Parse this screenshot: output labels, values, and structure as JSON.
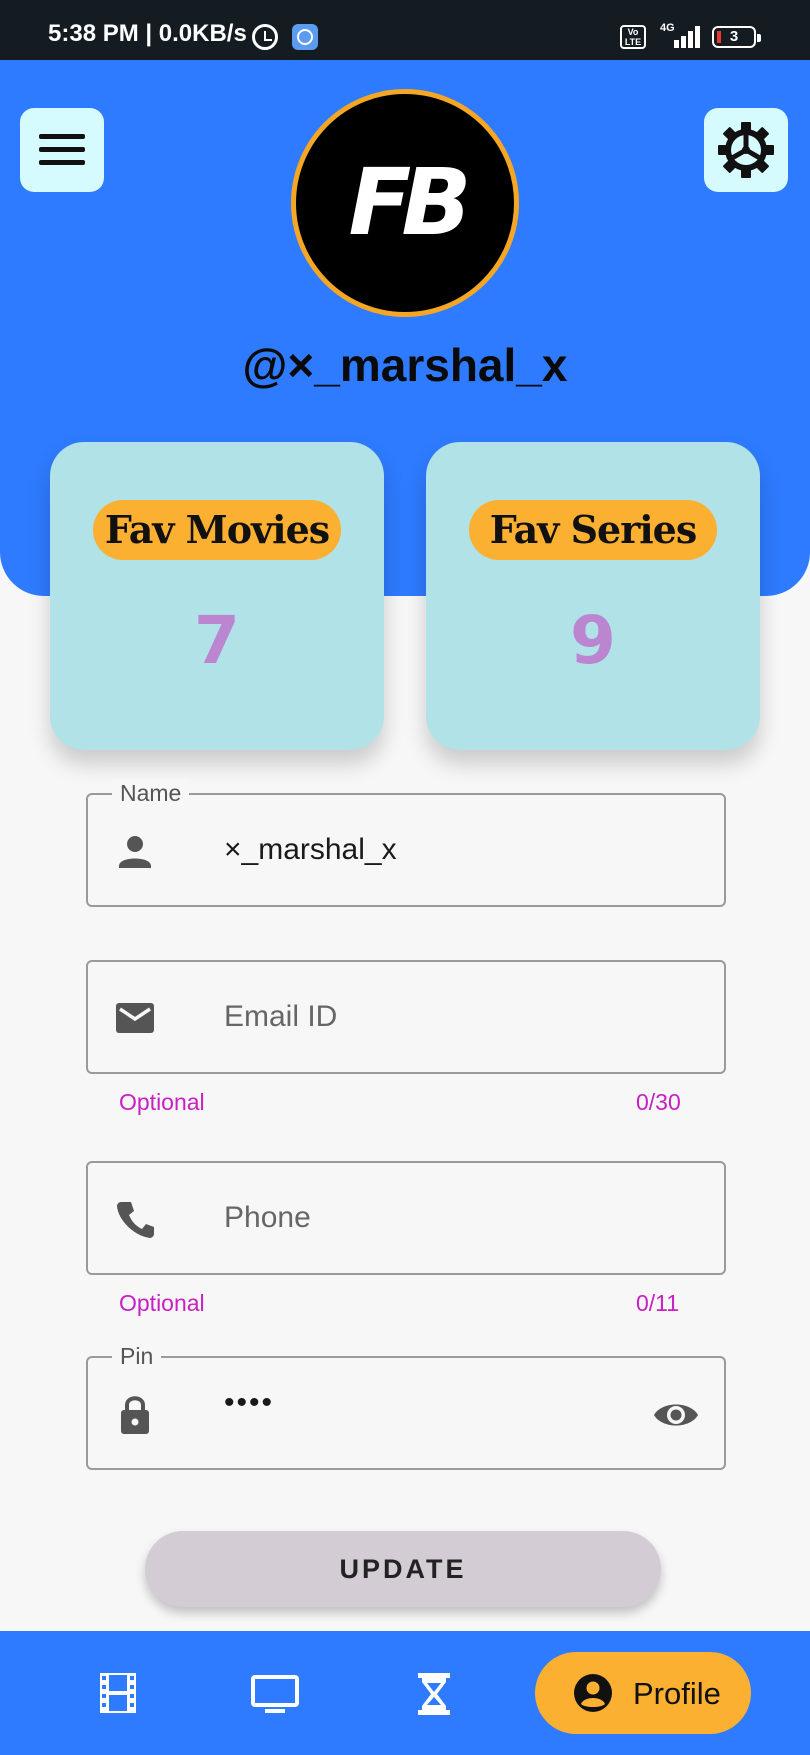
{
  "status_bar": {
    "time": "5:38 PM | 0.0KB/s",
    "volte": "Vo LTE",
    "network": "4G",
    "battery": "3"
  },
  "header": {
    "menu_icon": "hamburger-menu-icon",
    "settings_icon": "gear-icon",
    "avatar_logo": "FB",
    "username": "@×_marshal_x",
    "colors": {
      "header_bg": "#2e7bff",
      "avatar_ring": "#f5a623"
    }
  },
  "favorites": {
    "movies": {
      "label": "Fav Movies",
      "count": "7"
    },
    "series": {
      "label": "Fav Series",
      "count": "9"
    }
  },
  "form": {
    "name": {
      "label": "Name",
      "value": "×_marshal_x",
      "icon": "person-icon"
    },
    "email": {
      "placeholder": "Email ID",
      "helper": "Optional",
      "counter": "0/30",
      "icon": "mail-icon"
    },
    "phone": {
      "placeholder": "Phone",
      "helper": "Optional",
      "counter": "0/11",
      "icon": "phone-icon"
    },
    "pin": {
      "label": "Pin",
      "value": "••••",
      "icon": "lock-icon",
      "toggle_icon": "eye-icon"
    },
    "update_label": "UPDATE"
  },
  "bottom_nav": {
    "items": [
      {
        "icon": "film-icon"
      },
      {
        "icon": "tv-icon"
      },
      {
        "icon": "hourglass-icon"
      },
      {
        "icon": "account-circle-icon",
        "label": "Profile",
        "active": true
      }
    ],
    "colors": {
      "nav_bg": "#2e7bff",
      "active_pill": "#fbb031"
    }
  }
}
